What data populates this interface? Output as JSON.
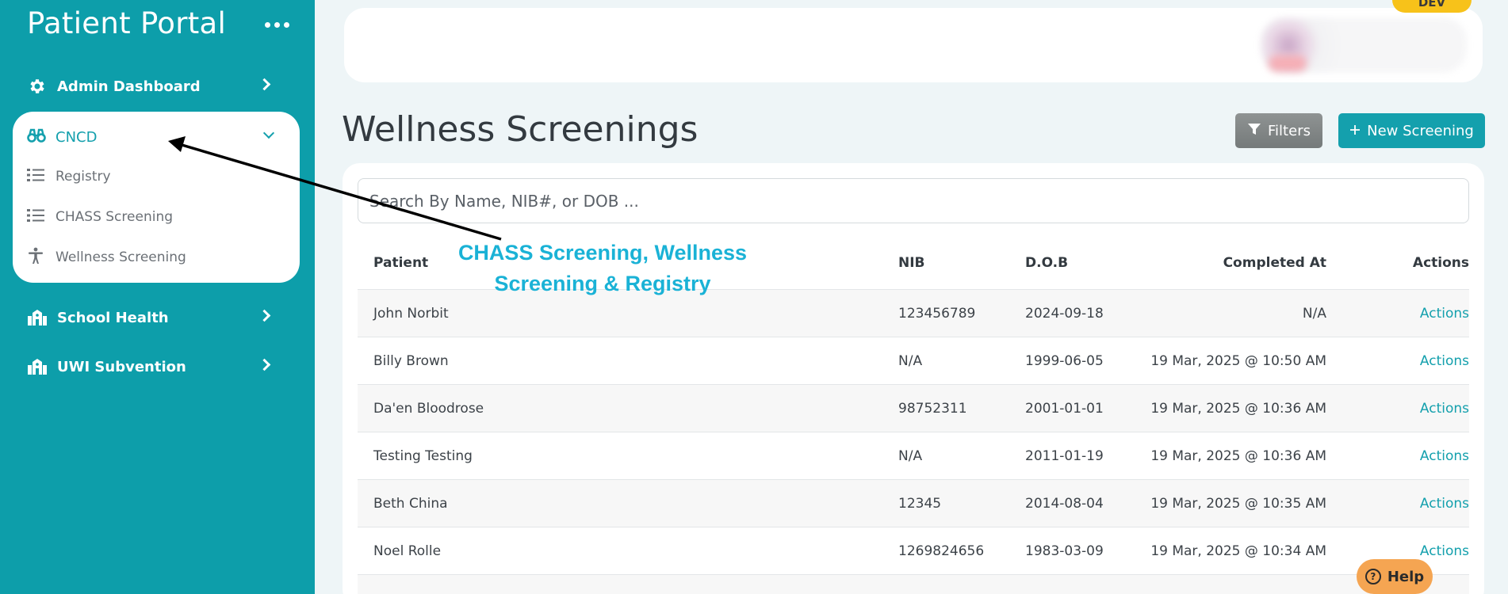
{
  "sidebar": {
    "brand": "Patient Portal",
    "items": [
      {
        "label": "Admin Dashboard"
      },
      {
        "label": "CNCD"
      },
      {
        "label": "School Health"
      },
      {
        "label": "UWI Subvention"
      }
    ],
    "cncd_sub": [
      {
        "label": "Registry"
      },
      {
        "label": "CHASS Screening"
      },
      {
        "label": "Wellness Screening"
      }
    ]
  },
  "header": {
    "dev_badge": "DEV"
  },
  "page": {
    "title": "Wellness Screenings",
    "filters_label": "Filters",
    "new_label": "New Screening"
  },
  "search": {
    "placeholder": "Search By Name, NIB#, or DOB ..."
  },
  "table": {
    "columns": [
      "Patient",
      "NIB",
      "D.O.B",
      "Completed At",
      "Actions"
    ],
    "rows": [
      {
        "patient": "John Norbit",
        "nib": "123456789",
        "dob": "2024-09-18",
        "completed": "N/A",
        "action": "Actions"
      },
      {
        "patient": "Billy Brown",
        "nib": "N/A",
        "dob": "1999-06-05",
        "completed": "19 Mar, 2025 @ 10:50 AM",
        "action": "Actions"
      },
      {
        "patient": "Da'en Bloodrose",
        "nib": "98752311",
        "dob": "2001-01-01",
        "completed": "19 Mar, 2025 @ 10:36 AM",
        "action": "Actions"
      },
      {
        "patient": "Testing Testing",
        "nib": "N/A",
        "dob": "2011-01-19",
        "completed": "19 Mar, 2025 @ 10:36 AM",
        "action": "Actions"
      },
      {
        "patient": "Beth China",
        "nib": "12345",
        "dob": "2014-08-04",
        "completed": "19 Mar, 2025 @ 10:35 AM",
        "action": "Actions"
      },
      {
        "patient": "Noel Rolle",
        "nib": "1269824656",
        "dob": "1983-03-09",
        "completed": "19 Mar, 2025 @ 10:34 AM",
        "action": "Actions"
      }
    ]
  },
  "annotation": {
    "line1": "CHASS Screening,  Wellness",
    "line2": "Screening & Registry"
  },
  "help": {
    "label": "Help"
  },
  "colors": {
    "sidebar": "#0d9eaa",
    "accent": "#14a0ad",
    "annotation": "#1ab2d6",
    "dev": "#f7c21a",
    "help": "#f5a552"
  }
}
